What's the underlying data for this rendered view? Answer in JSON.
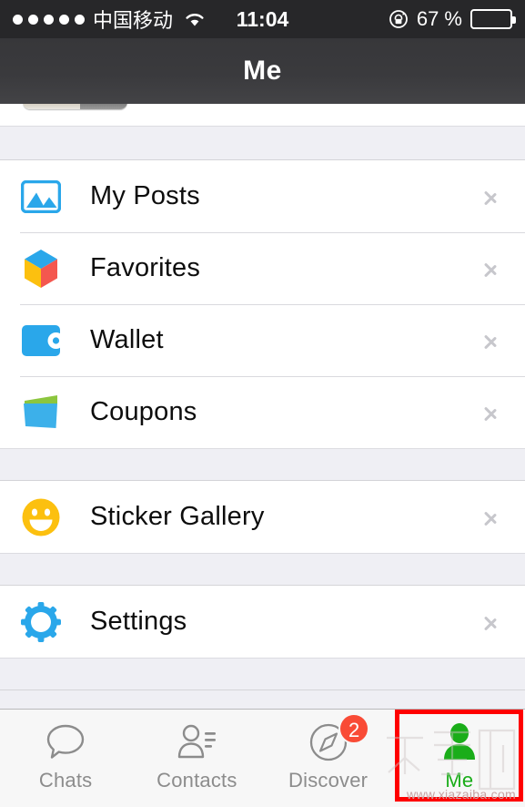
{
  "status_bar": {
    "signal_dots": 5,
    "carrier": "中国移动",
    "wifi_icon": "wifi-icon",
    "time": "11:04",
    "rotation_lock_icon": "rotation-lock-icon",
    "battery_percent": "67 %",
    "battery_level": 67
  },
  "nav": {
    "title": "Me"
  },
  "sections": [
    {
      "id": "media-section",
      "rows": [
        {
          "id": "my-posts",
          "label": "My Posts",
          "icon": "photo-icon",
          "chevron": "chevron-right-icon"
        },
        {
          "id": "favorites",
          "label": "Favorites",
          "icon": "cube-icon",
          "chevron": "chevron-right-icon"
        },
        {
          "id": "wallet",
          "label": "Wallet",
          "icon": "wallet-icon",
          "chevron": "chevron-right-icon"
        },
        {
          "id": "coupons",
          "label": "Coupons",
          "icon": "card-icon",
          "chevron": "chevron-right-icon"
        }
      ]
    },
    {
      "id": "sticker-section",
      "rows": [
        {
          "id": "sticker-gallery",
          "label": "Sticker Gallery",
          "icon": "smiley-icon",
          "chevron": "chevron-right-icon"
        }
      ]
    },
    {
      "id": "settings-section",
      "rows": [
        {
          "id": "settings",
          "label": "Settings",
          "icon": "gear-icon",
          "chevron": "chevron-right-icon"
        }
      ]
    }
  ],
  "tab_bar": {
    "tabs": [
      {
        "id": "chats",
        "label": "Chats",
        "icon": "speech-bubble-icon",
        "active": false,
        "badge": ""
      },
      {
        "id": "contacts",
        "label": "Contacts",
        "icon": "contacts-icon",
        "active": false,
        "badge": ""
      },
      {
        "id": "discover",
        "label": "Discover",
        "icon": "compass-icon",
        "active": false,
        "badge": "2"
      },
      {
        "id": "me",
        "label": "Me",
        "icon": "person-icon",
        "active": true,
        "badge": ""
      }
    ],
    "active_color": "#1aad19",
    "inactive_color": "#8c8c8c",
    "badge_color": "#f94b36"
  },
  "annotations": {
    "highlight_color": "#ff0000",
    "highlight_target": "me-tab"
  },
  "watermark": {
    "text": "下载吧",
    "url": "www.xiazaiba.com"
  },
  "colors": {
    "nav_bar": "#3a3a3d",
    "status_bar": "#272729",
    "group_background": "#ffffff",
    "page_background": "#efeff4",
    "icon_blue": "#2aa7ea",
    "icon_yellow": "#fcc00f",
    "icon_green": "#8cc63e",
    "separator": "#d9d9de"
  }
}
